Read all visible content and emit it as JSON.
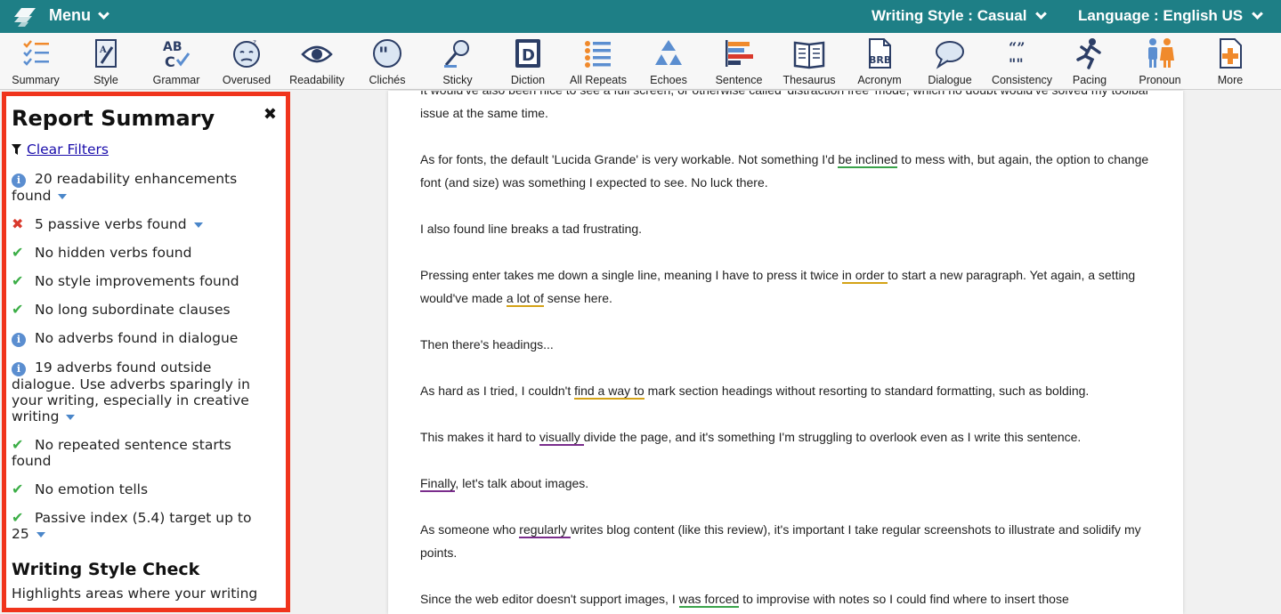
{
  "topbar": {
    "menu_label": "Menu",
    "writing_style": "Writing Style : Casual",
    "language": "Language : English US"
  },
  "toolbar": [
    {
      "label": "Summary",
      "icon": "summary-icon"
    },
    {
      "label": "Style",
      "icon": "style-icon"
    },
    {
      "label": "Grammar",
      "icon": "grammar-icon"
    },
    {
      "label": "Overused",
      "icon": "overused-icon"
    },
    {
      "label": "Readability",
      "icon": "eye-icon"
    },
    {
      "label": "Clichés",
      "icon": "quote-bubble-icon"
    },
    {
      "label": "Sticky",
      "icon": "sticky-icon"
    },
    {
      "label": "Diction",
      "icon": "diction-icon"
    },
    {
      "label": "All Repeats",
      "icon": "list-icon"
    },
    {
      "label": "Echoes",
      "icon": "recycle-icon"
    },
    {
      "label": "Sentence",
      "icon": "sentence-bars-icon"
    },
    {
      "label": "Thesaurus",
      "icon": "book-icon"
    },
    {
      "label": "Acronym",
      "icon": "acronym-icon"
    },
    {
      "label": "Dialogue",
      "icon": "speech-bubble-icon"
    },
    {
      "label": "Consistency",
      "icon": "quotes-icon"
    },
    {
      "label": "Pacing",
      "icon": "running-icon"
    },
    {
      "label": "Pronoun",
      "icon": "people-icon"
    },
    {
      "label": "More",
      "icon": "plus-doc-icon"
    }
  ],
  "sidebar": {
    "title": "Report Summary",
    "clear_filters": "Clear Filters",
    "items": [
      {
        "status": "info",
        "text": "20 readability enhancements found",
        "expandable": true
      },
      {
        "status": "error",
        "text": "5 passive verbs found",
        "expandable": true
      },
      {
        "status": "ok",
        "text": "No hidden verbs found",
        "expandable": false
      },
      {
        "status": "ok",
        "text": "No style improvements found",
        "expandable": false
      },
      {
        "status": "ok",
        "text": "No long subordinate clauses",
        "expandable": false
      },
      {
        "status": "info",
        "text": "No adverbs found in dialogue",
        "expandable": false
      },
      {
        "status": "info",
        "text": "19 adverbs found outside dialogue. Use adverbs sparingly in your writing, especially in creative writing",
        "expandable": true
      },
      {
        "status": "ok",
        "text": "No repeated sentence starts found",
        "expandable": false
      },
      {
        "status": "ok",
        "text": "No emotion tells",
        "expandable": false
      },
      {
        "status": "ok",
        "text": "Passive index (5.4) target up to 25",
        "expandable": true
      }
    ],
    "section2_title": "Writing Style Check",
    "section2_desc": "Highlights areas where your writing"
  },
  "document": {
    "p0": {
      "a": "It would've also been nice to see a full screen, or otherwise called 'distraction free' mode, which no doubt would've solved my toolbar issue at the same time."
    },
    "p1": {
      "a": "As for fonts, the default 'Lucida Grande' is very workable. Not something I'd ",
      "h1": "be inclined",
      "b": " to mess with, but again, the option to change font (and size) was something I expected to see. No luck there."
    },
    "p2": {
      "a": "I also found line breaks a tad frustrating."
    },
    "p3": {
      "a": "Pressing enter takes me down a single line, meaning I have to press it twice ",
      "h1": "in order ",
      "b": "to start a new paragraph. Yet again, a setting would've made ",
      "h2": "a lot of",
      "c": " sense here."
    },
    "p4": {
      "a": "Then there's headings..."
    },
    "p5": {
      "a": "As hard as I tried, I couldn't ",
      "h1": "find a way to",
      "b": " mark section headings without resorting to standard formatting, such as bolding."
    },
    "p6": {
      "a": "This makes it hard to ",
      "h1": "visually ",
      "b": "divide the page, and it's something I'm struggling to overlook even as I write this sentence."
    },
    "p7": {
      "h1": "Finally",
      "a": ", let's talk about images."
    },
    "p8": {
      "a": "As someone who ",
      "h1": "regularly ",
      "b": "writes blog content (like this review), it's important I take regular screenshots to illustrate and solidify my points."
    },
    "p9": {
      "a": "Since the web editor doesn't support images, I ",
      "h1": "was forced",
      "b": " to improvise with notes so I could find where to insert those"
    }
  },
  "colors": {
    "brand": "#1e7f86",
    "highlight_box": "#f0341c",
    "ok": "#3cae47",
    "error": "#d9392c",
    "info": "#5b8ed0"
  }
}
